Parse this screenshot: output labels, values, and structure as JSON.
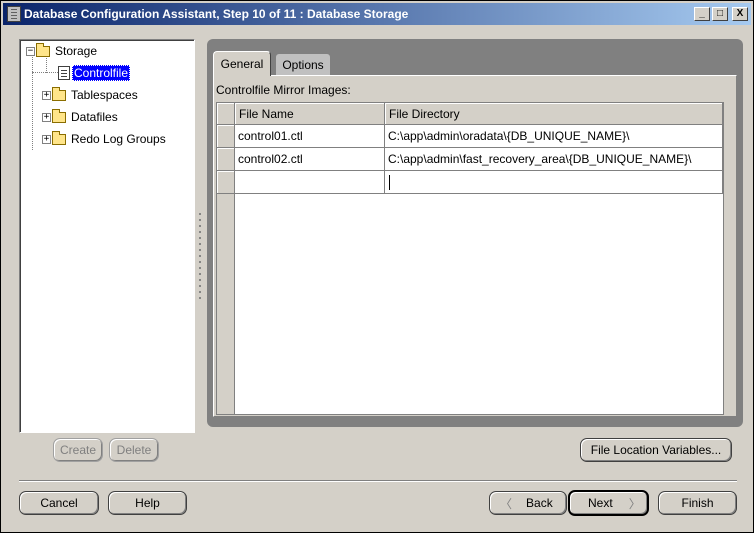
{
  "window": {
    "title": "Database Configuration Assistant, Step 10 of 11 : Database Storage",
    "controls": {
      "minimize": "_",
      "maximize": "□",
      "close": "X"
    }
  },
  "tree": {
    "root": {
      "label": "Storage",
      "expander": "−"
    },
    "children": [
      {
        "label": "Controlfile",
        "selected": true
      },
      {
        "label": "Tablespaces",
        "expander": "+"
      },
      {
        "label": "Datafiles",
        "expander": "+"
      },
      {
        "label": "Redo Log Groups",
        "expander": "+"
      }
    ]
  },
  "tree_actions": {
    "create": "Create",
    "delete": "Delete"
  },
  "tabs": [
    {
      "label": "General",
      "active": true
    },
    {
      "label": "Options",
      "active": false
    }
  ],
  "general": {
    "caption": "Controlfile Mirror Images:",
    "columns": [
      "File Name",
      "File Directory"
    ],
    "rows": [
      {
        "file_name": "control01.ctl",
        "file_directory": "C:\\app\\admin\\oradata\\{DB_UNIQUE_NAME}\\"
      },
      {
        "file_name": "control02.ctl",
        "file_directory": "C:\\app\\admin\\fast_recovery_area\\{DB_UNIQUE_NAME}\\"
      },
      {
        "file_name": "",
        "file_directory": ""
      }
    ]
  },
  "file_location_button": "File Location Variables...",
  "footer": {
    "cancel": "Cancel",
    "help": "Help",
    "back": "Back",
    "next": "Next",
    "finish": "Finish"
  }
}
